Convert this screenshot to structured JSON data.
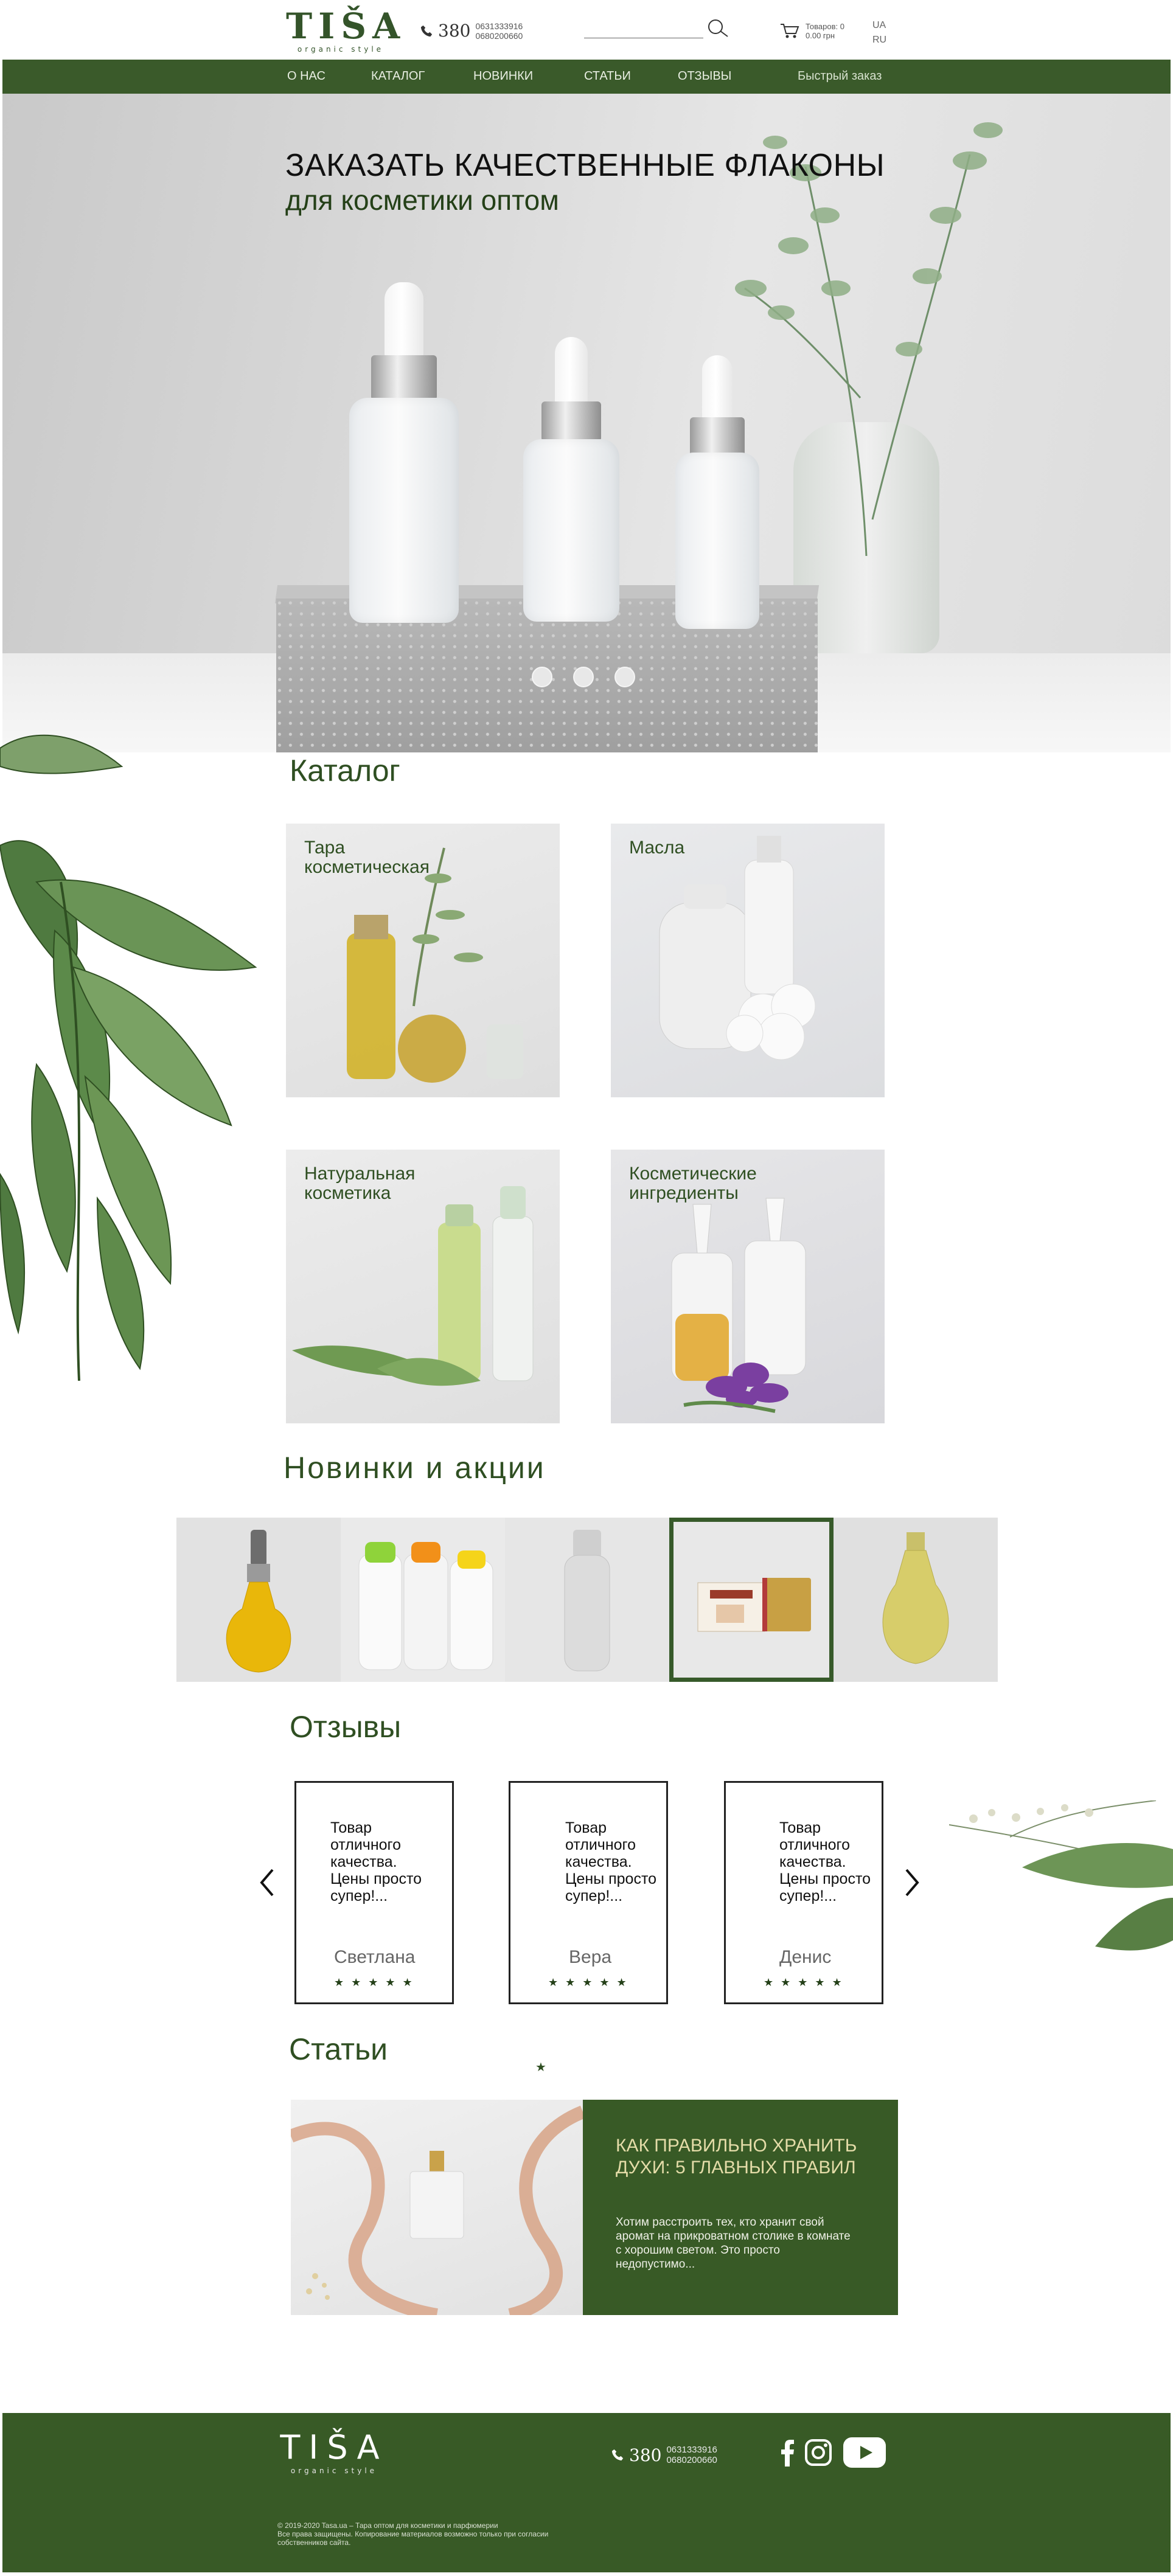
{
  "brand": {
    "name": "TIŠA",
    "tagline": "organic style"
  },
  "header": {
    "phone_code": "380",
    "phones": [
      "0631333916",
      "0680200660"
    ],
    "search_placeholder": "",
    "cart": {
      "line1": "Товаров: 0",
      "line2": "0.00 грн"
    },
    "languages": [
      "UA",
      "RU"
    ]
  },
  "nav": {
    "items": [
      "О НАС",
      "КАТАЛОГ",
      "НОВИНКИ",
      "СТАТЬИ",
      "ОТЗЫВЫ"
    ],
    "fast_order": "Быстрый заказ"
  },
  "hero": {
    "title": "ЗАКАЗАТЬ КАЧЕСТВЕННЫЕ ФЛАКОНЫ",
    "subtitle": "для косметики оптом",
    "slides": 3,
    "active_slide": 1
  },
  "catalog": {
    "title": "Каталог",
    "items": [
      {
        "label": "Тара косметическая"
      },
      {
        "label": "Масла"
      },
      {
        "label": "Натуральная косметика"
      },
      {
        "label": "Косметические ингредиенты"
      }
    ]
  },
  "new_products": {
    "title": "Новинки и акции",
    "items": [
      "oil-dispenser-bottle",
      "colored-cap-bottles",
      "clear-plastic-bottle",
      "soap-box",
      "yellow-plastic-bottle"
    ],
    "active_index": 3
  },
  "reviews": {
    "title": "Отзывы",
    "items": [
      {
        "text": "Товар отличного качества. Цены просто супер!...",
        "name": "Светлана",
        "stars": "★★★★★"
      },
      {
        "text": "Товар отличного качества. Цены просто супер!...",
        "name": "Вера",
        "stars": "★★★★★"
      },
      {
        "text": "Товар отличного качества. Цены просто супер!...",
        "name": "Денис",
        "stars": "★★★★★"
      }
    ],
    "dot": "★"
  },
  "articles": {
    "title": "Статьи",
    "items": [
      {
        "title": "КАК ПРАВИЛЬНО ХРАНИТЬ ДУХИ: 5 ГЛАВНЫХ ПРАВИЛ",
        "text": "Хотим расстроить тех, кто хранит свой аромат на прикроватном столике в комнате с хорошим светом. Это просто недопустимо..."
      }
    ]
  },
  "footer": {
    "phone_code": "380",
    "phones": [
      "0631333916",
      "0680200660"
    ],
    "social": [
      "facebook-icon",
      "instagram-icon",
      "youtube-icon"
    ],
    "copyright": "© 2019-2020 Tasa.ua – Тара оптом для косметики и парфюмерии",
    "rights": "Все права защищены. Копирование материалов возможно только при согласии собственников сайта."
  },
  "colors": {
    "brand_green": "#385a26",
    "nav_green": "#3a5a2a",
    "accent_text": "#e4dca8"
  }
}
